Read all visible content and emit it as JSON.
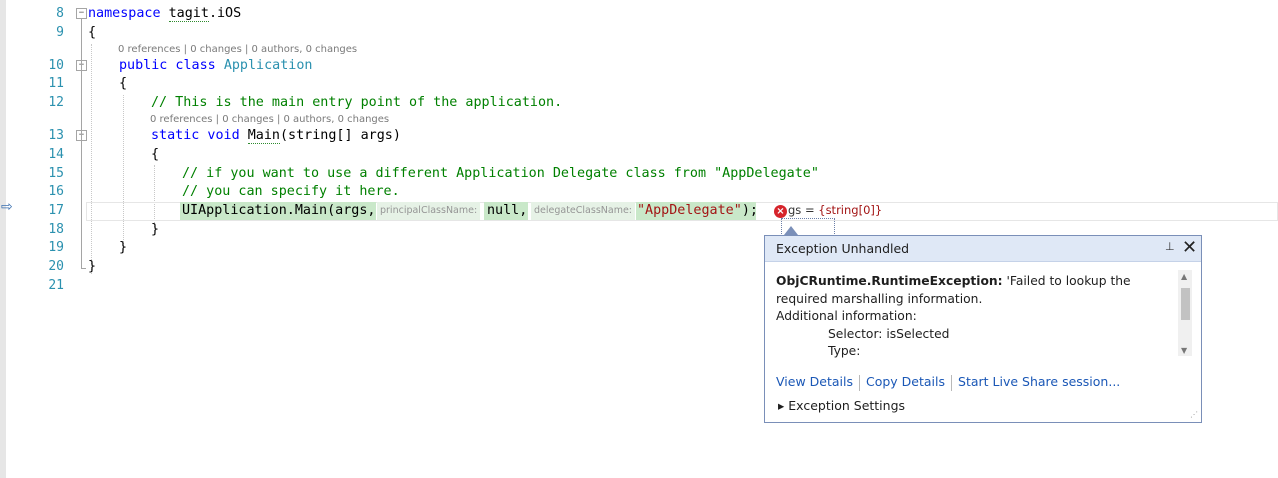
{
  "editor": {
    "lines": [
      {
        "num": "8"
      },
      {
        "num": "9"
      },
      {
        "num": "10"
      },
      {
        "num": "11"
      },
      {
        "num": "12"
      },
      {
        "num": "13"
      },
      {
        "num": "14"
      },
      {
        "num": "15"
      },
      {
        "num": "16"
      },
      {
        "num": "17"
      },
      {
        "num": "18"
      },
      {
        "num": "19"
      },
      {
        "num": "20"
      },
      {
        "num": "21"
      }
    ],
    "code": {
      "l8_kw": "namespace",
      "l8_name": "tagit",
      "l8_rest": ".iOS",
      "brace_open": "{",
      "brace_close": "}",
      "l10_kw": "public class",
      "l10_type": "Application",
      "l12_comment": "// This is the main entry point of the application.",
      "l13_kw": "static void",
      "l13_method": "Main",
      "l13_rest": "(string[] args)",
      "l15_comment": "// if you want to use a different Application Delegate class from \"AppDelegate\"",
      "l16_comment": "// you can specify it here.",
      "l17_call": "UIApplication.Main(args, ",
      "l17_hint1": "principalClassName:",
      "l17_null": "null, ",
      "l17_hint2": "delegateClassName:",
      "l17_str": "\"AppDelegate\"",
      "l17_end": ");"
    },
    "codelens": {
      "class": "0 references | 0 changes | 0 authors, 0 changes",
      "method": "0 references | 0 changes | 0 authors, 0 changes"
    },
    "datatip": {
      "name": "gs = ",
      "value": "{string[0]}"
    }
  },
  "exception_popup": {
    "title": "Exception Unhandled",
    "exception_type": "ObjCRuntime.RuntimeException:",
    "message": " 'Failed to lookup the required marshalling information.",
    "additional_label": "Additional information:",
    "selector_line": "Selector: isSelected",
    "type_line": "Type:",
    "links": {
      "view_details": "View Details",
      "copy_details": "Copy Details",
      "live_share": "Start Live Share session..."
    },
    "settings_label": "Exception Settings",
    "pin_icon": "pin-icon",
    "close_icon": "close-icon"
  }
}
